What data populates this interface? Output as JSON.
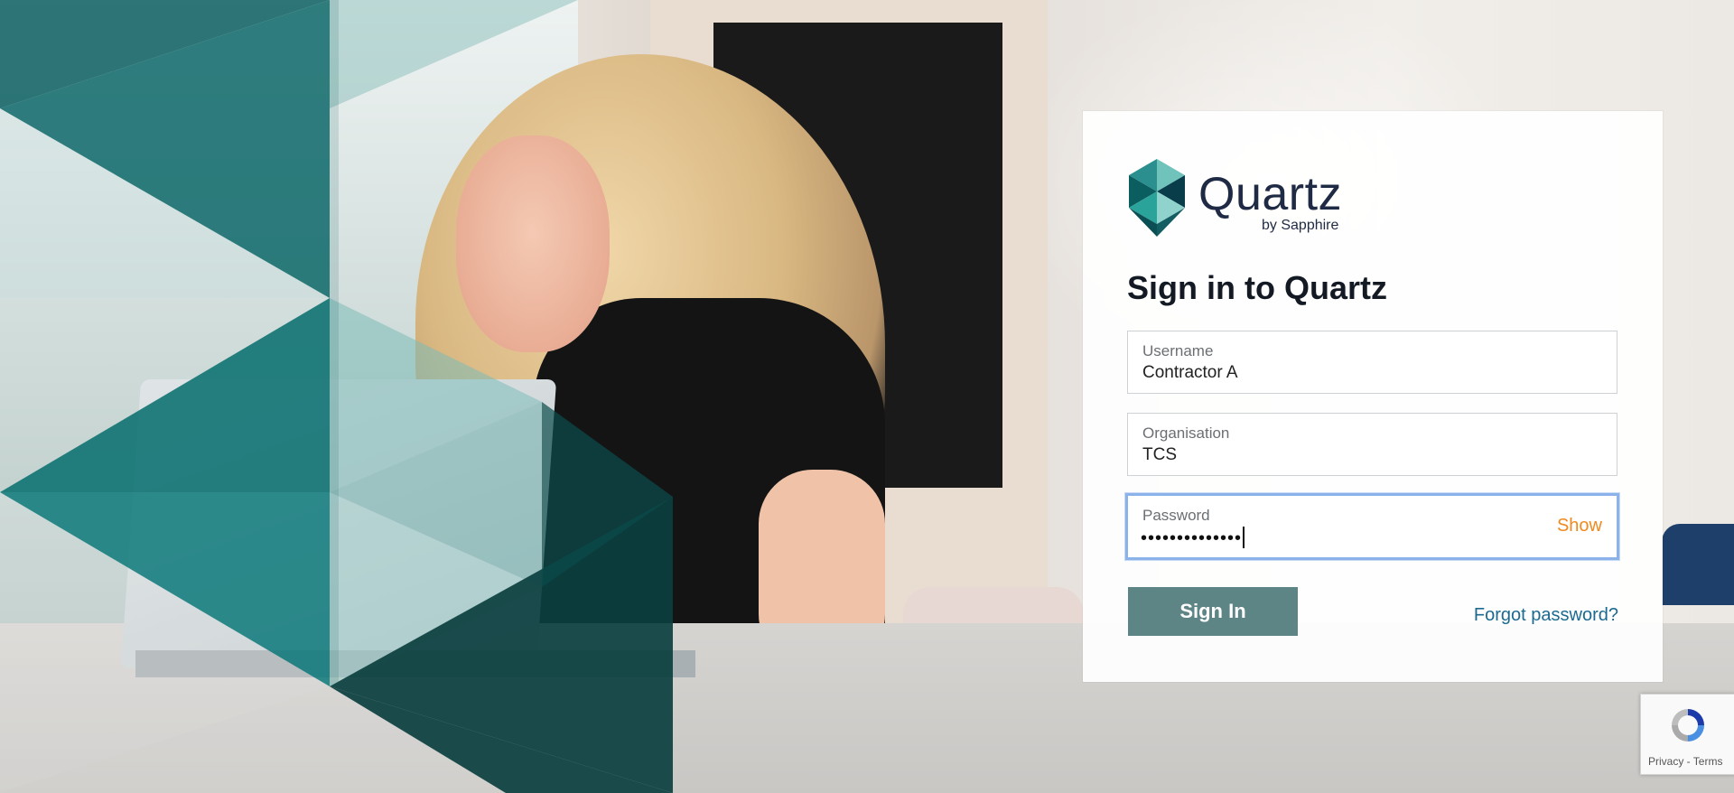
{
  "login": {
    "logo_word": "Quartz",
    "logo_sub": "by Sapphire",
    "title": "Sign in to Quartz",
    "username": {
      "label": "Username",
      "value": "Contractor A"
    },
    "organisation": {
      "label": "Organisation",
      "value": "TCS"
    },
    "password": {
      "label": "Password",
      "masked_value": "••••••••••••••",
      "toggle_label": "Show"
    },
    "signin_label": "Sign In",
    "forgot_label": "Forgot password?"
  },
  "recaptcha": {
    "privacy": "Privacy",
    "separator": " - ",
    "terms": "Terms"
  },
  "colors": {
    "teal_dark": "#0b5e60",
    "teal_mid": "#2b8f8f",
    "signin_bg": "#5e8585",
    "show_link": "#ee8a20",
    "forgot_link": "#1c6a8f",
    "focus_border": "#8bb3e9"
  },
  "icons": {
    "logo": "quartz-logo-icon",
    "recaptcha": "recaptcha-icon"
  }
}
